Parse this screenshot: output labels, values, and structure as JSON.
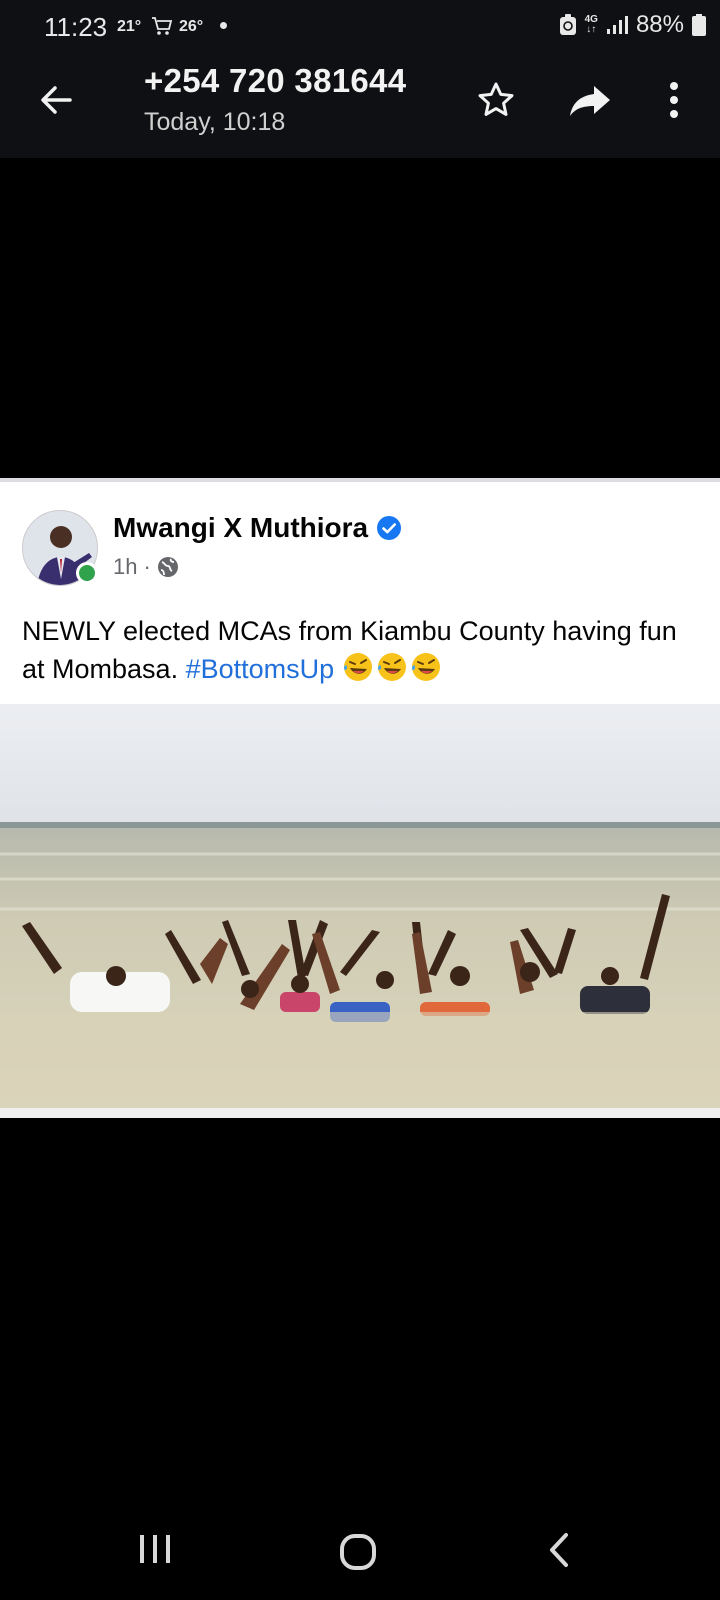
{
  "status_bar": {
    "time": "11:23",
    "temp_1": "21°",
    "temp_2": "26°",
    "network": "4G",
    "battery": "88%"
  },
  "header": {
    "title": "+254 720 381644",
    "subtitle": "Today, 10:18"
  },
  "post": {
    "author": "Mwangi X Muthiora",
    "time": "1h",
    "separator": "·",
    "text": "NEWLY elected MCAs from Kiambu County having fun at Mombasa.",
    "hashtag": "#BottomsUp",
    "emoji_count": 3
  },
  "colors": {
    "bar_bg": "#0e1013",
    "hashtag": "#216fdb",
    "verified": "#1877f2",
    "online": "#31a24c"
  }
}
